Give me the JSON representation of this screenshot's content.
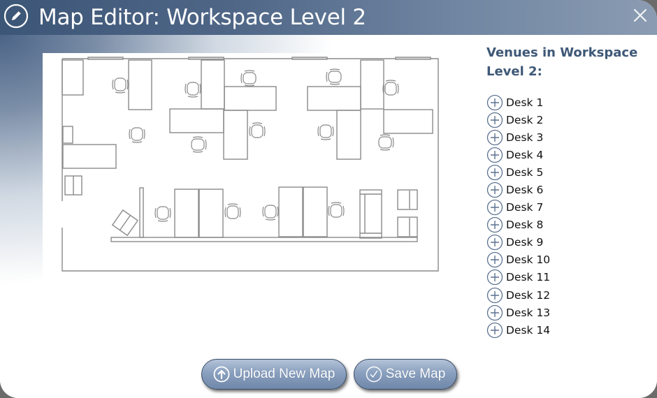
{
  "window": {
    "title": "Map Editor: Workspace Level 2",
    "title_icon": "pencil-icon",
    "close_icon": "close-icon"
  },
  "colors": {
    "titlebar": "#4f6687",
    "accent_text": "#3e5877",
    "button": "#8aa0bf"
  },
  "map": {
    "description": "Floor plan of Workspace Level 2",
    "image_icon": "floor-plan-image"
  },
  "venues": {
    "title": "Venues in Workspace Level 2:",
    "item_icon": "plus-circle-icon",
    "items": [
      {
        "label": "Desk 1"
      },
      {
        "label": "Desk 2"
      },
      {
        "label": "Desk 3"
      },
      {
        "label": "Desk 4"
      },
      {
        "label": "Desk 5"
      },
      {
        "label": "Desk 6"
      },
      {
        "label": "Desk 7"
      },
      {
        "label": "Desk 8"
      },
      {
        "label": "Desk 9"
      },
      {
        "label": "Desk 10"
      },
      {
        "label": "Desk 11"
      },
      {
        "label": "Desk 12"
      },
      {
        "label": "Desk 13"
      },
      {
        "label": "Desk 14"
      }
    ]
  },
  "actions": {
    "upload_label": "Upload New Map",
    "upload_icon": "arrow-up-circle-icon",
    "save_label": "Save Map",
    "save_icon": "check-circle-icon"
  }
}
